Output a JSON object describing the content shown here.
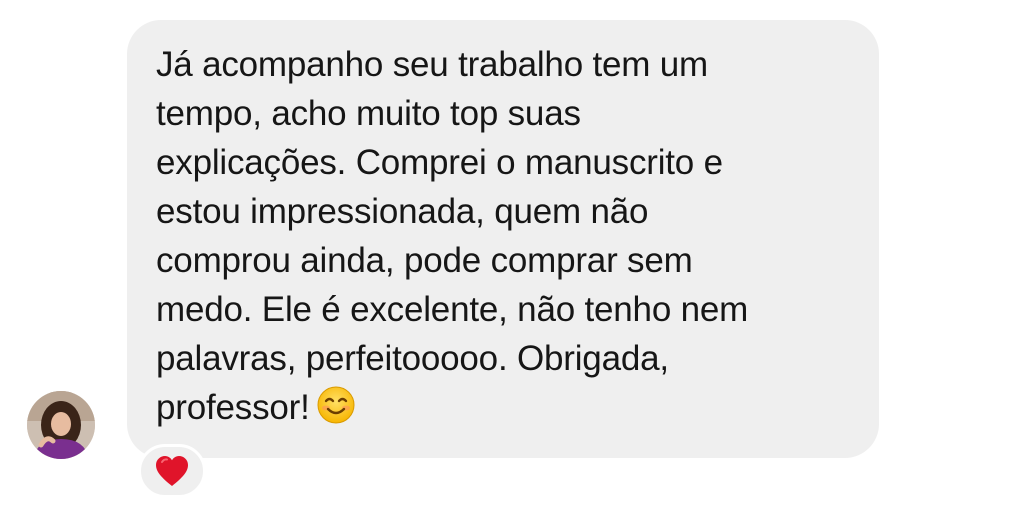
{
  "message": {
    "lines": [
      "Já acompanho seu trabalho tem um",
      "tempo, acho muito top suas",
      "explicações. Comprei o manuscrito e",
      "estou impressionada, quem não",
      "comprou ainda, pode comprar sem",
      "medo. Ele é excelente,  não tenho nem",
      "palavras,  perfeitooooo. Obrigada,",
      "professor!"
    ],
    "trailing_emoji": "smiling-face-emoji",
    "bubble_color": "#efefef",
    "text_color": "#161616"
  },
  "sender": {
    "avatar_icon": "user-avatar"
  },
  "reaction": {
    "icon": "red-heart-icon",
    "color": "#e0142a"
  }
}
